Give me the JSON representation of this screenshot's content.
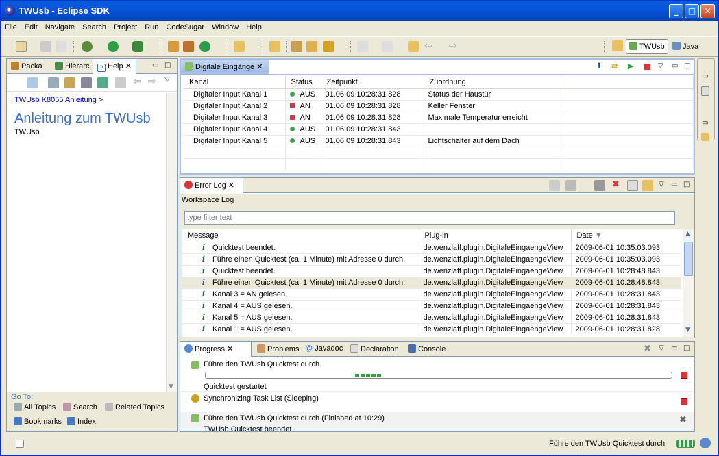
{
  "window": {
    "title": "TWUsb - Eclipse SDK"
  },
  "menu": [
    "File",
    "Edit",
    "Navigate",
    "Search",
    "Project",
    "Run",
    "CodeSugar",
    "Window",
    "Help"
  ],
  "perspectives": {
    "active": "TWUsb",
    "other": "Java"
  },
  "left": {
    "tabs": [
      "Packa",
      "Hierarc",
      "Help"
    ],
    "breadcrumb": "TWUsb K8055 Anleitung",
    "breadcrumb_sep": ">",
    "heading": "Anleitung zum TWUsb",
    "subtitle": "TWUsb",
    "goto_label": "Go To:",
    "goto": {
      "all_topics": "All Topics",
      "search": "Search",
      "related": "Related Topics",
      "bookmarks": "Bookmarks",
      "index": "Index"
    }
  },
  "inputs_view": {
    "tab": "Digitale Eingänge",
    "columns": [
      "Kanal",
      "Status",
      "Zeitpunkt",
      "Zuordnung"
    ],
    "rows": [
      {
        "kanal": "Digitaler Input Kanal 1",
        "state": "off",
        "status": "AUS",
        "zeit": "01.06.09 10:28:31 828",
        "zuordnung": "Status der Haustür"
      },
      {
        "kanal": "Digitaler Input Kanal 2",
        "state": "on",
        "status": "AN",
        "zeit": "01.06.09 10:28:31 828",
        "zuordnung": "Keller Fenster"
      },
      {
        "kanal": "Digitaler Input Kanal 3",
        "state": "on",
        "status": "AN",
        "zeit": "01.06.09 10:28:31 828",
        "zuordnung": "Maximale Temperatur erreicht"
      },
      {
        "kanal": "Digitaler Input Kanal 4",
        "state": "off",
        "status": "AUS",
        "zeit": "01.06.09 10:28:31 843",
        "zuordnung": ""
      },
      {
        "kanal": "Digitaler Input Kanal 5",
        "state": "off",
        "status": "AUS",
        "zeit": "01.06.09 10:28:31 843",
        "zuordnung": "Lichtschalter auf dem Dach"
      }
    ]
  },
  "error_log": {
    "tab": "Error Log",
    "workspace": "Workspace Log",
    "filter_placeholder": "type filter text",
    "columns": [
      "Message",
      "Plug-in",
      "Date"
    ],
    "rows": [
      {
        "msg": "Quicktest beendet.",
        "plugin": "de.wenzlaff.plugin.DigitaleEingaengeView",
        "date": "2009-06-01 10:35:03.093"
      },
      {
        "msg": "Führe einen Quicktest (ca. 1 Minute) mit Adresse 0 durch.",
        "plugin": "de.wenzlaff.plugin.DigitaleEingaengeView",
        "date": "2009-06-01 10:35:03.093"
      },
      {
        "msg": "Quicktest beendet.",
        "plugin": "de.wenzlaff.plugin.DigitaleEingaengeView",
        "date": "2009-06-01 10:28:48.843"
      },
      {
        "msg": "Führe einen Quicktest (ca. 1 Minute) mit Adresse 0 durch.",
        "plugin": "de.wenzlaff.plugin.DigitaleEingaengeView",
        "date": "2009-06-01 10:28:48.843"
      },
      {
        "msg": "Kanal 3 = AN gelesen.",
        "plugin": "de.wenzlaff.plugin.DigitaleEingaengeView",
        "date": "2009-06-01 10:28:31.843"
      },
      {
        "msg": "Kanal 4 = AUS gelesen.",
        "plugin": "de.wenzlaff.plugin.DigitaleEingaengeView",
        "date": "2009-06-01 10:28:31.843"
      },
      {
        "msg": "Kanal 5 = AUS gelesen.",
        "plugin": "de.wenzlaff.plugin.DigitaleEingaengeView",
        "date": "2009-06-01 10:28:31.843"
      },
      {
        "msg": "Kanal 1 = AUS gelesen.",
        "plugin": "de.wenzlaff.plugin.DigitaleEingaengeView",
        "date": "2009-06-01 10:28:31.828"
      }
    ]
  },
  "progress": {
    "tabs": [
      "Progress",
      "Problems",
      "Javadoc",
      "Declaration",
      "Console"
    ],
    "jobs": [
      {
        "title": "Führe den TWUsb Quicktest durch",
        "sub": "Quicktest gestartet"
      },
      {
        "title": "Synchronizing Task List (Sleeping)"
      },
      {
        "title": "Führe den TWUsb Quicktest durch (Finished at 10:29)",
        "sub": "TWUsb Quicktest beendet"
      }
    ]
  },
  "status": {
    "text": "Führe den TWUsb Quicktest durch"
  },
  "colors": {
    "accent": "#0a246a",
    "title": "#3a70c5",
    "on": "#d9343c",
    "off": "#3aa24b"
  }
}
